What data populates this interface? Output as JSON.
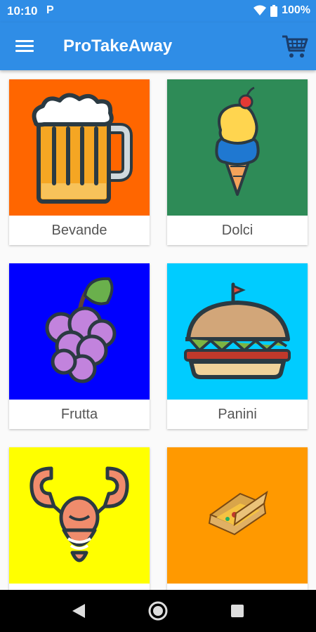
{
  "status_bar": {
    "time": "10:10",
    "carrier_badge": "P",
    "battery": "100%"
  },
  "app_bar": {
    "title": "ProTakeAway"
  },
  "categories": [
    {
      "label": "Bevande",
      "bg": "#ff6600",
      "icon": "beer-mug-icon"
    },
    {
      "label": "Dolci",
      "bg": "#2e8b57",
      "icon": "ice-cream-cone-icon"
    },
    {
      "label": "Frutta",
      "bg": "#0000ff",
      "icon": "grapes-icon"
    },
    {
      "label": "Panini",
      "bg": "#00ccff",
      "icon": "burger-icon"
    },
    {
      "label": "",
      "bg": "#ffff00",
      "icon": "lobster-icon"
    },
    {
      "label": "",
      "bg": "#ff9900",
      "icon": "pizza-box-icon"
    }
  ],
  "colors": {
    "primary": "#2f8de6",
    "nav_bar": "#000000"
  }
}
